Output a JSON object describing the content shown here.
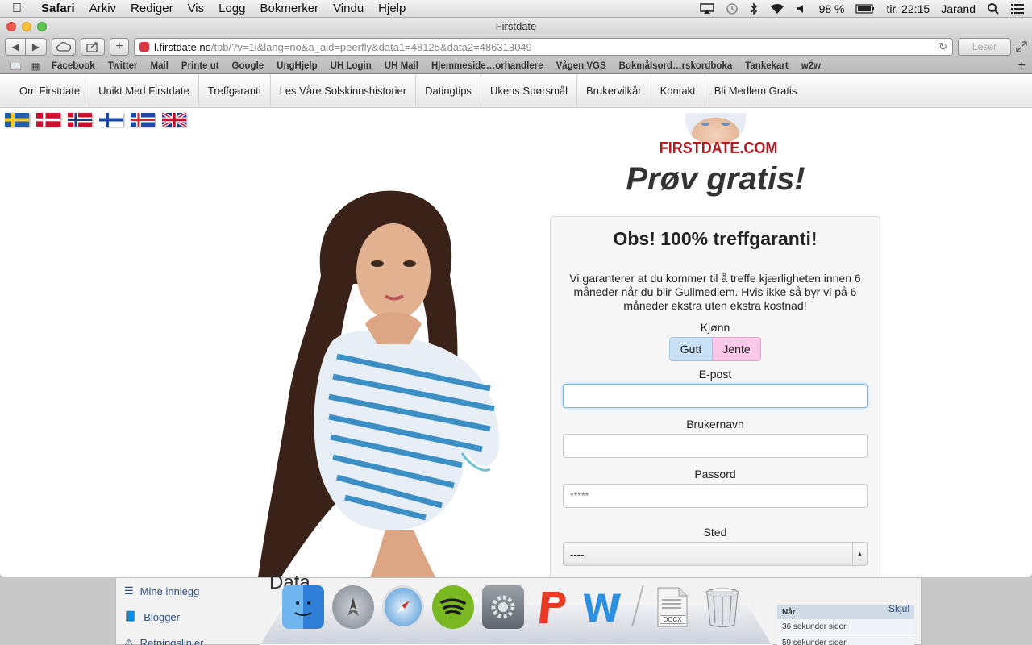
{
  "menubar": {
    "apple": "",
    "items": [
      "Safari",
      "Arkiv",
      "Rediger",
      "Vis",
      "Logg",
      "Bokmerker",
      "Vindu",
      "Hjelp"
    ],
    "battery": "98 %",
    "clock": "tir. 22:15",
    "user": "Jarand"
  },
  "browser": {
    "title": "Firstdate",
    "url_domain": "l.firstdate.no",
    "url_path": "/tpb/?v=1i&lang=no&a_aid=peerfly&data1=48125&data2=486313049",
    "reader_label": "Leser",
    "bookmarks": [
      "Facebook",
      "Twitter",
      "Mail",
      "Printe ut",
      "Google",
      "UngHjelp",
      "UH Login",
      "UH Mail",
      "Hjemmeside…orhandlere",
      "Vågen VGS",
      "Bokmålsord…rskordboka",
      "Tankekart",
      "w2w"
    ]
  },
  "site_nav": [
    "Om Firstdate",
    "Unikt Med Firstdate",
    "Treffgaranti",
    "Les Våre Solskinnshistorier",
    "Datingtips",
    "Ukens Spørsmål",
    "Brukervilkår",
    "Kontakt",
    "Bli Medlem Gratis"
  ],
  "flags": [
    "sweden",
    "denmark",
    "norway",
    "finland",
    "iceland",
    "uk"
  ],
  "brand": {
    "logo_text": "FIRSTDATE.COM",
    "tagline": "Prøv gratis!"
  },
  "form": {
    "title": "Obs! 100% treffgaranti!",
    "description": "Vi garanterer at du kommer til å treffe kjærligheten innen 6 måneder når du blir Gullmedlem. Hvis ikke så byr vi på 6 måneder ekstra uten ekstra kostnad!",
    "gender_label": "Kjønn",
    "gender_male": "Gutt",
    "gender_female": "Jente",
    "email_label": "E-post",
    "email_value": "",
    "username_label": "Brukernavn",
    "username_value": "",
    "password_label": "Passord",
    "password_placeholder": "*****",
    "location_label": "Sted",
    "location_value": "----"
  },
  "background_window": {
    "side_items": [
      "Mine innlegg",
      "Blogger",
      "Retningslinjer"
    ],
    "heading": "Data",
    "table_header": "Når",
    "table_toggle": "Skjul",
    "table_rows": [
      "36 sekunder siden",
      "59 sekunder siden"
    ]
  },
  "dock": {
    "docx_label": "DOCX"
  }
}
